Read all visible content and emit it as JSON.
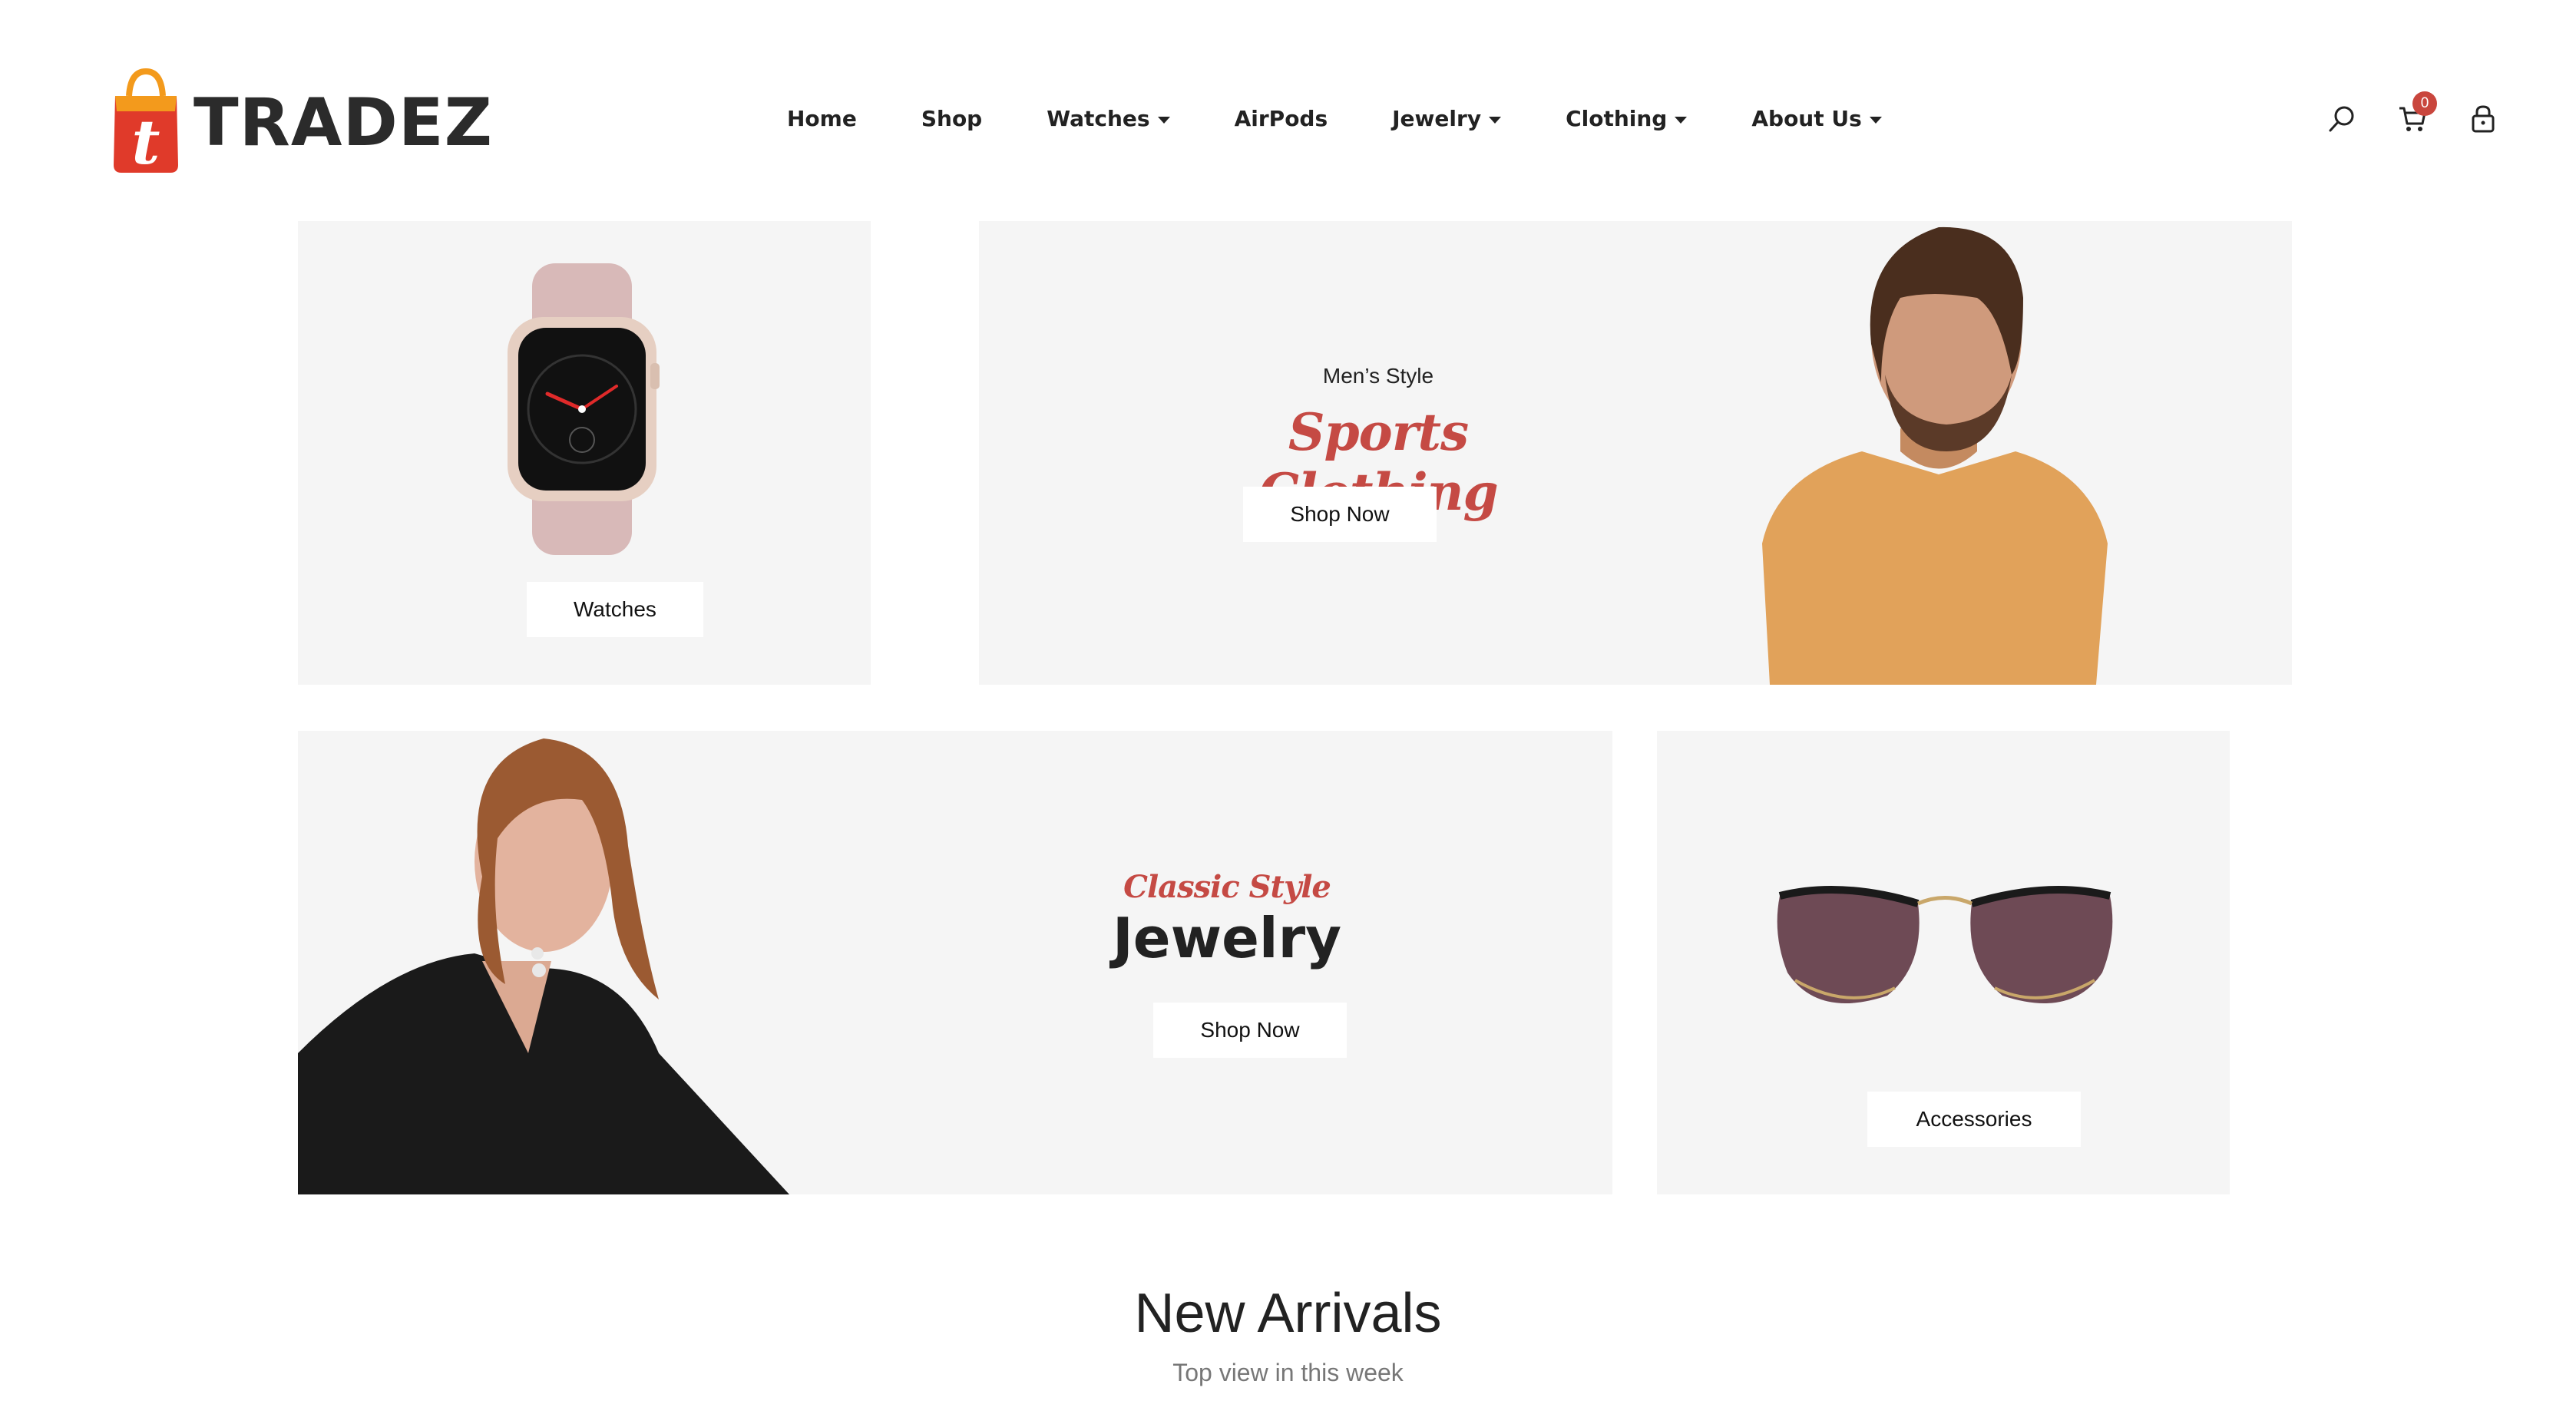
{
  "brand": {
    "name": "TRADEZ",
    "logo_letter": "t",
    "accent_color": "#e03a2a",
    "accent_color_2": "#f39a1c"
  },
  "nav": {
    "items": [
      {
        "label": "Home",
        "has_dropdown": false
      },
      {
        "label": "Shop",
        "has_dropdown": false
      },
      {
        "label": "Watches",
        "has_dropdown": true
      },
      {
        "label": "AirPods",
        "has_dropdown": false
      },
      {
        "label": "Jewelry",
        "has_dropdown": true
      },
      {
        "label": "Clothing",
        "has_dropdown": true
      },
      {
        "label": "About Us",
        "has_dropdown": true
      }
    ]
  },
  "header_icons": {
    "search": "search-icon",
    "cart": "cart-icon",
    "account": "lock-bag-icon",
    "cart_count": "0"
  },
  "banners": {
    "watches": {
      "button": "Watches",
      "image": "smartwatch-image"
    },
    "sports": {
      "eyebrow": "Men’s Style",
      "script_title": "Sports Clothing",
      "button": "Shop Now",
      "image": "man-orange-tshirt-image"
    },
    "jewelry": {
      "script_eyebrow": "Classic Style",
      "title": "Jewelry",
      "button": "Shop Now",
      "image": "woman-earrings-image"
    },
    "accessories": {
      "button": "Accessories",
      "image": "sunglasses-image"
    }
  },
  "new_arrivals": {
    "title": "New Arrivals",
    "subtitle": "Top view in this week"
  }
}
